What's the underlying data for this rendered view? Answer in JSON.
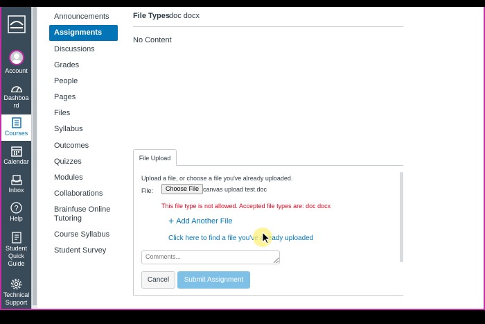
{
  "global_nav": {
    "items": [
      {
        "label": "Account",
        "icon": "avatar-icon"
      },
      {
        "label": "Dashboa rd",
        "icon": "dashboard-icon"
      },
      {
        "label": "Courses",
        "icon": "courses-icon",
        "active": true
      },
      {
        "label": "Calendar",
        "icon": "calendar-icon"
      },
      {
        "label": "Inbox",
        "icon": "inbox-icon"
      },
      {
        "label": "Help",
        "icon": "help-icon"
      },
      {
        "label": "Student Quick Guide",
        "icon": "guide-icon"
      },
      {
        "label": "Technical Support",
        "icon": "gear-icon"
      }
    ]
  },
  "course_nav": {
    "items": [
      {
        "label": "Announcements"
      },
      {
        "label": "Assignments",
        "active": true
      },
      {
        "label": "Discussions"
      },
      {
        "label": "Grades"
      },
      {
        "label": "People"
      },
      {
        "label": "Pages"
      },
      {
        "label": "Files"
      },
      {
        "label": "Syllabus"
      },
      {
        "label": "Outcomes"
      },
      {
        "label": "Quizzes"
      },
      {
        "label": "Modules"
      },
      {
        "label": "Collaborations"
      },
      {
        "label": "Brainfuse Online Tutoring"
      },
      {
        "label": "Course Syllabus"
      },
      {
        "label": "Student Survey"
      }
    ]
  },
  "assignment": {
    "file_types_label": "File Types",
    "file_types_value": "doc docx",
    "body": "No Content"
  },
  "upload": {
    "tab_label": "File Upload",
    "instructions": "Upload a file, or choose a file you've already uploaded.",
    "file_label": "File:",
    "choose_button": "Choose File",
    "selected_file": "canvas upload test.doc",
    "error": "This file type is not allowed. Accepted file types are: doc docx",
    "add_another": "Add Another File",
    "find_link": "Click here to find a file you've already uploaded",
    "comments_placeholder": "Comments...",
    "cancel_button": "Cancel",
    "submit_button": "Submit Assignment"
  },
  "colors": {
    "nav_bg": "#394b58",
    "brand": "#0374b5",
    "error": "#e0061f",
    "frame_accent": "#c42ea4"
  }
}
